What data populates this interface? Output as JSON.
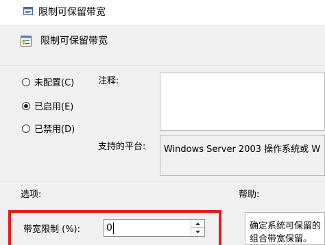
{
  "window": {
    "title": "限制可保留带宽"
  },
  "header": {
    "title": "限制可保留带宽"
  },
  "radios": [
    {
      "label": "未配置(C)",
      "selected": false
    },
    {
      "label": "已启用(E)",
      "selected": true
    },
    {
      "label": "已禁用(D)",
      "selected": false
    }
  ],
  "comment": {
    "label": "注释:",
    "value": ""
  },
  "platform": {
    "label": "支持的平台:",
    "value": "Windows Server 2003 操作系统或 W"
  },
  "options": {
    "label": "选项:",
    "bandwidth_label": "带宽限制 (%):",
    "bandwidth_value": "0"
  },
  "help": {
    "label": "帮助:",
    "line1": "确定系统可保留的",
    "line2": "组合带宽保留。"
  },
  "colors": {
    "highlight": "#e51c1c",
    "window_bg": "#f0f0f0"
  }
}
